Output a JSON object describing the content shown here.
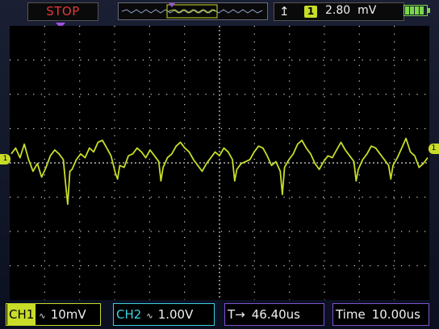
{
  "status": {
    "run_state": "STOP",
    "run_state_color": "#e03a3a"
  },
  "trigger": {
    "edge_icon": "rising-edge-icon",
    "edge_glyph": "↑̸",
    "source": "1",
    "level": "2.80",
    "level_unit": "mV"
  },
  "battery": {
    "level": 1.0,
    "color": "#7bd64a"
  },
  "ch1": {
    "tag": "CH1",
    "coupling_glyph": "∿",
    "volts_div": "10mV",
    "color": "#c8dc28",
    "marker": "1"
  },
  "ch2": {
    "tag": "CH2",
    "coupling_glyph": "∿",
    "volts_div": "1.00V",
    "color": "#3cd0e0"
  },
  "trigger_delay": {
    "label": "T→",
    "value": "46.40us"
  },
  "timebase": {
    "label": "Time",
    "value": "10.00us"
  },
  "waveform": {
    "description_points": [
      [
        0,
        0.3
      ],
      [
        2,
        0.6
      ],
      [
        4,
        0.1
      ],
      [
        6,
        0.8
      ],
      [
        8,
        0.0
      ],
      [
        10,
        -0.6
      ],
      [
        12,
        -0.2
      ],
      [
        14,
        -0.9
      ],
      [
        16,
        -0.4
      ],
      [
        18,
        0.2
      ],
      [
        20,
        0.5
      ],
      [
        22,
        0.3
      ],
      [
        24,
        0.0
      ],
      [
        25,
        -1.2
      ],
      [
        26,
        -2.3
      ],
      [
        27,
        -0.6
      ],
      [
        28,
        -0.5
      ],
      [
        30,
        0.0
      ],
      [
        32,
        0.3
      ],
      [
        34,
        0.1
      ],
      [
        36,
        0.6
      ],
      [
        38,
        0.4
      ],
      [
        40,
        0.9
      ],
      [
        42,
        1.0
      ],
      [
        44,
        0.6
      ],
      [
        46,
        0.2
      ],
      [
        48,
        -0.7
      ],
      [
        49,
        -1.0
      ],
      [
        50,
        -0.3
      ],
      [
        52,
        -0.4
      ],
      [
        54,
        0.2
      ],
      [
        56,
        0.3
      ],
      [
        58,
        0.6
      ],
      [
        60,
        0.4
      ],
      [
        62,
        0.1
      ],
      [
        64,
        0.5
      ],
      [
        66,
        0.2
      ],
      [
        68,
        -0.1
      ],
      [
        69,
        -1.1
      ],
      [
        70,
        -0.4
      ],
      [
        72,
        0.1
      ],
      [
        74,
        0.3
      ],
      [
        76,
        0.7
      ],
      [
        78,
        0.9
      ],
      [
        80,
        0.6
      ],
      [
        82,
        0.4
      ],
      [
        84,
        0.0
      ],
      [
        86,
        -0.3
      ],
      [
        88,
        -0.6
      ],
      [
        90,
        -0.2
      ],
      [
        92,
        0.1
      ],
      [
        94,
        0.4
      ],
      [
        96,
        0.2
      ],
      [
        98,
        0.6
      ],
      [
        100,
        0.4
      ],
      [
        102,
        0.0
      ],
      [
        103,
        -1.1
      ],
      [
        104,
        -0.5
      ],
      [
        106,
        -0.2
      ],
      [
        108,
        -0.1
      ],
      [
        110,
        0.0
      ],
      [
        112,
        0.4
      ],
      [
        114,
        0.7
      ],
      [
        116,
        0.6
      ],
      [
        118,
        0.2
      ],
      [
        120,
        -0.3
      ],
      [
        122,
        -0.1
      ],
      [
        124,
        -0.6
      ],
      [
        125,
        -1.8
      ],
      [
        126,
        -0.4
      ],
      [
        128,
        0.0
      ],
      [
        130,
        0.3
      ],
      [
        132,
        0.8
      ],
      [
        134,
        1.0
      ],
      [
        136,
        0.6
      ],
      [
        138,
        0.3
      ],
      [
        140,
        -0.2
      ],
      [
        142,
        -0.5
      ],
      [
        144,
        -0.1
      ],
      [
        146,
        0.2
      ],
      [
        148,
        0.1
      ],
      [
        150,
        0.5
      ],
      [
        152,
        0.9
      ],
      [
        154,
        0.5
      ],
      [
        156,
        0.2
      ],
      [
        158,
        -0.1
      ],
      [
        159,
        -1.1
      ],
      [
        160,
        -0.5
      ],
      [
        162,
        0.0
      ],
      [
        164,
        0.3
      ],
      [
        166,
        0.7
      ],
      [
        168,
        0.6
      ],
      [
        170,
        0.3
      ],
      [
        172,
        0.0
      ],
      [
        174,
        -0.3
      ],
      [
        175,
        -1.0
      ],
      [
        176,
        -0.3
      ],
      [
        178,
        0.1
      ],
      [
        180,
        0.6
      ],
      [
        182,
        1.1
      ],
      [
        184,
        0.4
      ],
      [
        186,
        0.2
      ],
      [
        188,
        -0.4
      ],
      [
        190,
        -0.2
      ],
      [
        192,
        0.1
      ]
    ]
  }
}
